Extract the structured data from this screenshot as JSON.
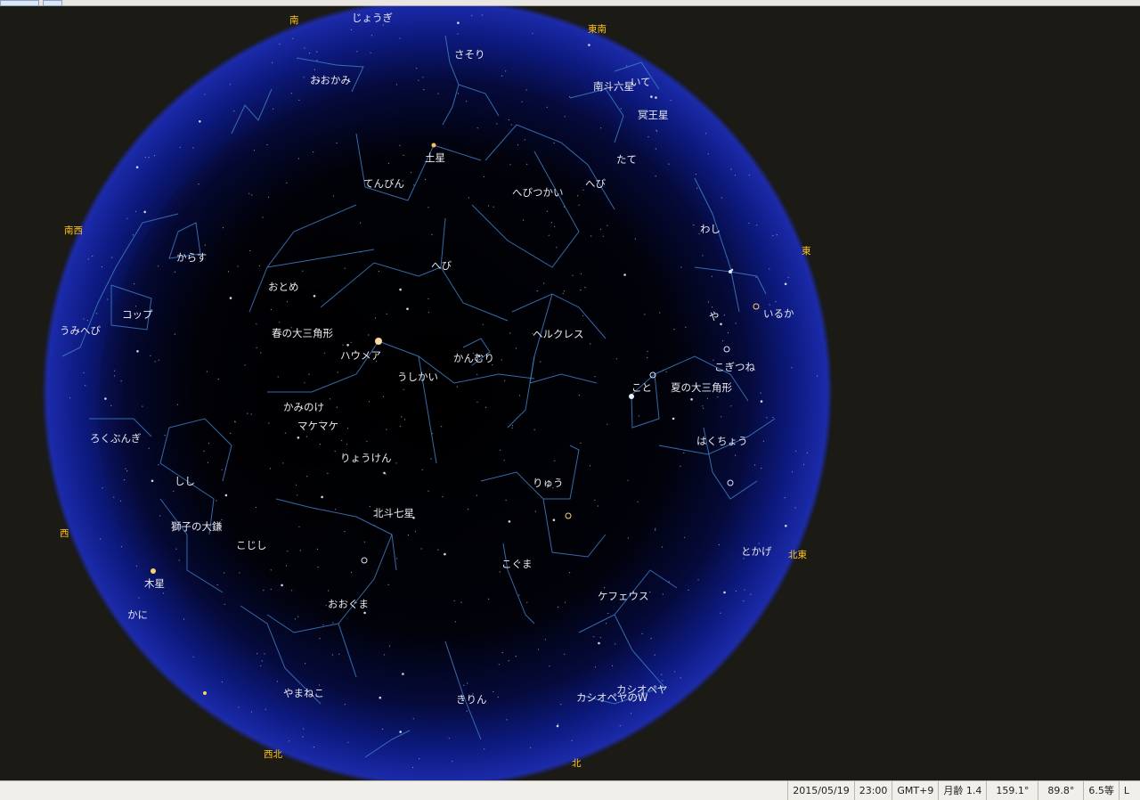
{
  "window": {
    "toolbar": [
      {
        "name": "toolbar-button-1"
      },
      {
        "name": "toolbar-button-2"
      }
    ]
  },
  "directions": {
    "south": "南",
    "southeast": "東南",
    "east": "東",
    "northeast": "北東",
    "north": "北",
    "northwest": "西北",
    "west": "西",
    "southwest": "南西"
  },
  "constellations": {
    "jougi": "じょうぎ",
    "sasori": "さそり",
    "ookami": "おおかみ",
    "nanto_rokusei": "南斗六星",
    "ite": "いて",
    "meiousei": "冥王星",
    "dosei": "土星",
    "tate": "たて",
    "tenbin": "てんびん",
    "hebitsukai": "へびつかい",
    "hebi1": "へび",
    "washi": "わし",
    "karasu": "からす",
    "hebi2": "へび",
    "otome": "おとめ",
    "iruka": "いるか",
    "koppu": "コップ",
    "ya": "や",
    "umihebi": "うみへび",
    "haru_sankaku": "春の大三角形",
    "hercules": "ヘルクレス",
    "haumea": "ハウメア",
    "kanmuri": "かんむり",
    "kogitsune": "こぎつね",
    "ushikai": "うしかい",
    "koto": "こと",
    "natsu_sankaku": "夏の大三角形",
    "kaminoke": "かみのけ",
    "makemake": "マケマケ",
    "rokubungi": "ろくぶんぎ",
    "hakuchou": "はくちょう",
    "ryouken": "りょうけん",
    "shishi": "しし",
    "ryuu": "りゅう",
    "hokuto": "北斗七星",
    "shishi_ookama": "獅子の大鎌",
    "koshishi": "こじし",
    "tokage": "とかげ",
    "kogumа": "こぐま",
    "mokusei": "木星",
    "cepheus": "ケフェウス",
    "ooguma": "おおぐま",
    "kani": "かに",
    "cassiopeia": "カシオペヤ",
    "yamaneko": "やまねこ",
    "kirin": "きりん",
    "cassiopeia_w": "カシオペヤのW"
  },
  "status": {
    "date": "2015/05/19",
    "time": "23:00",
    "timezone": "GMT+9",
    "moon_age": "月齢 1.4",
    "azimuth": "159.1°",
    "altitude": "89.8°",
    "magnitude": "6.5等",
    "mode": "L"
  },
  "colors": {
    "background": "#1b1a14",
    "sky_center": "#000000",
    "sky_edge": "#1a2aa8",
    "constellation_line": "#3f7cc4",
    "direction_label": "#ffc41a",
    "label": "#e8e8ee"
  }
}
